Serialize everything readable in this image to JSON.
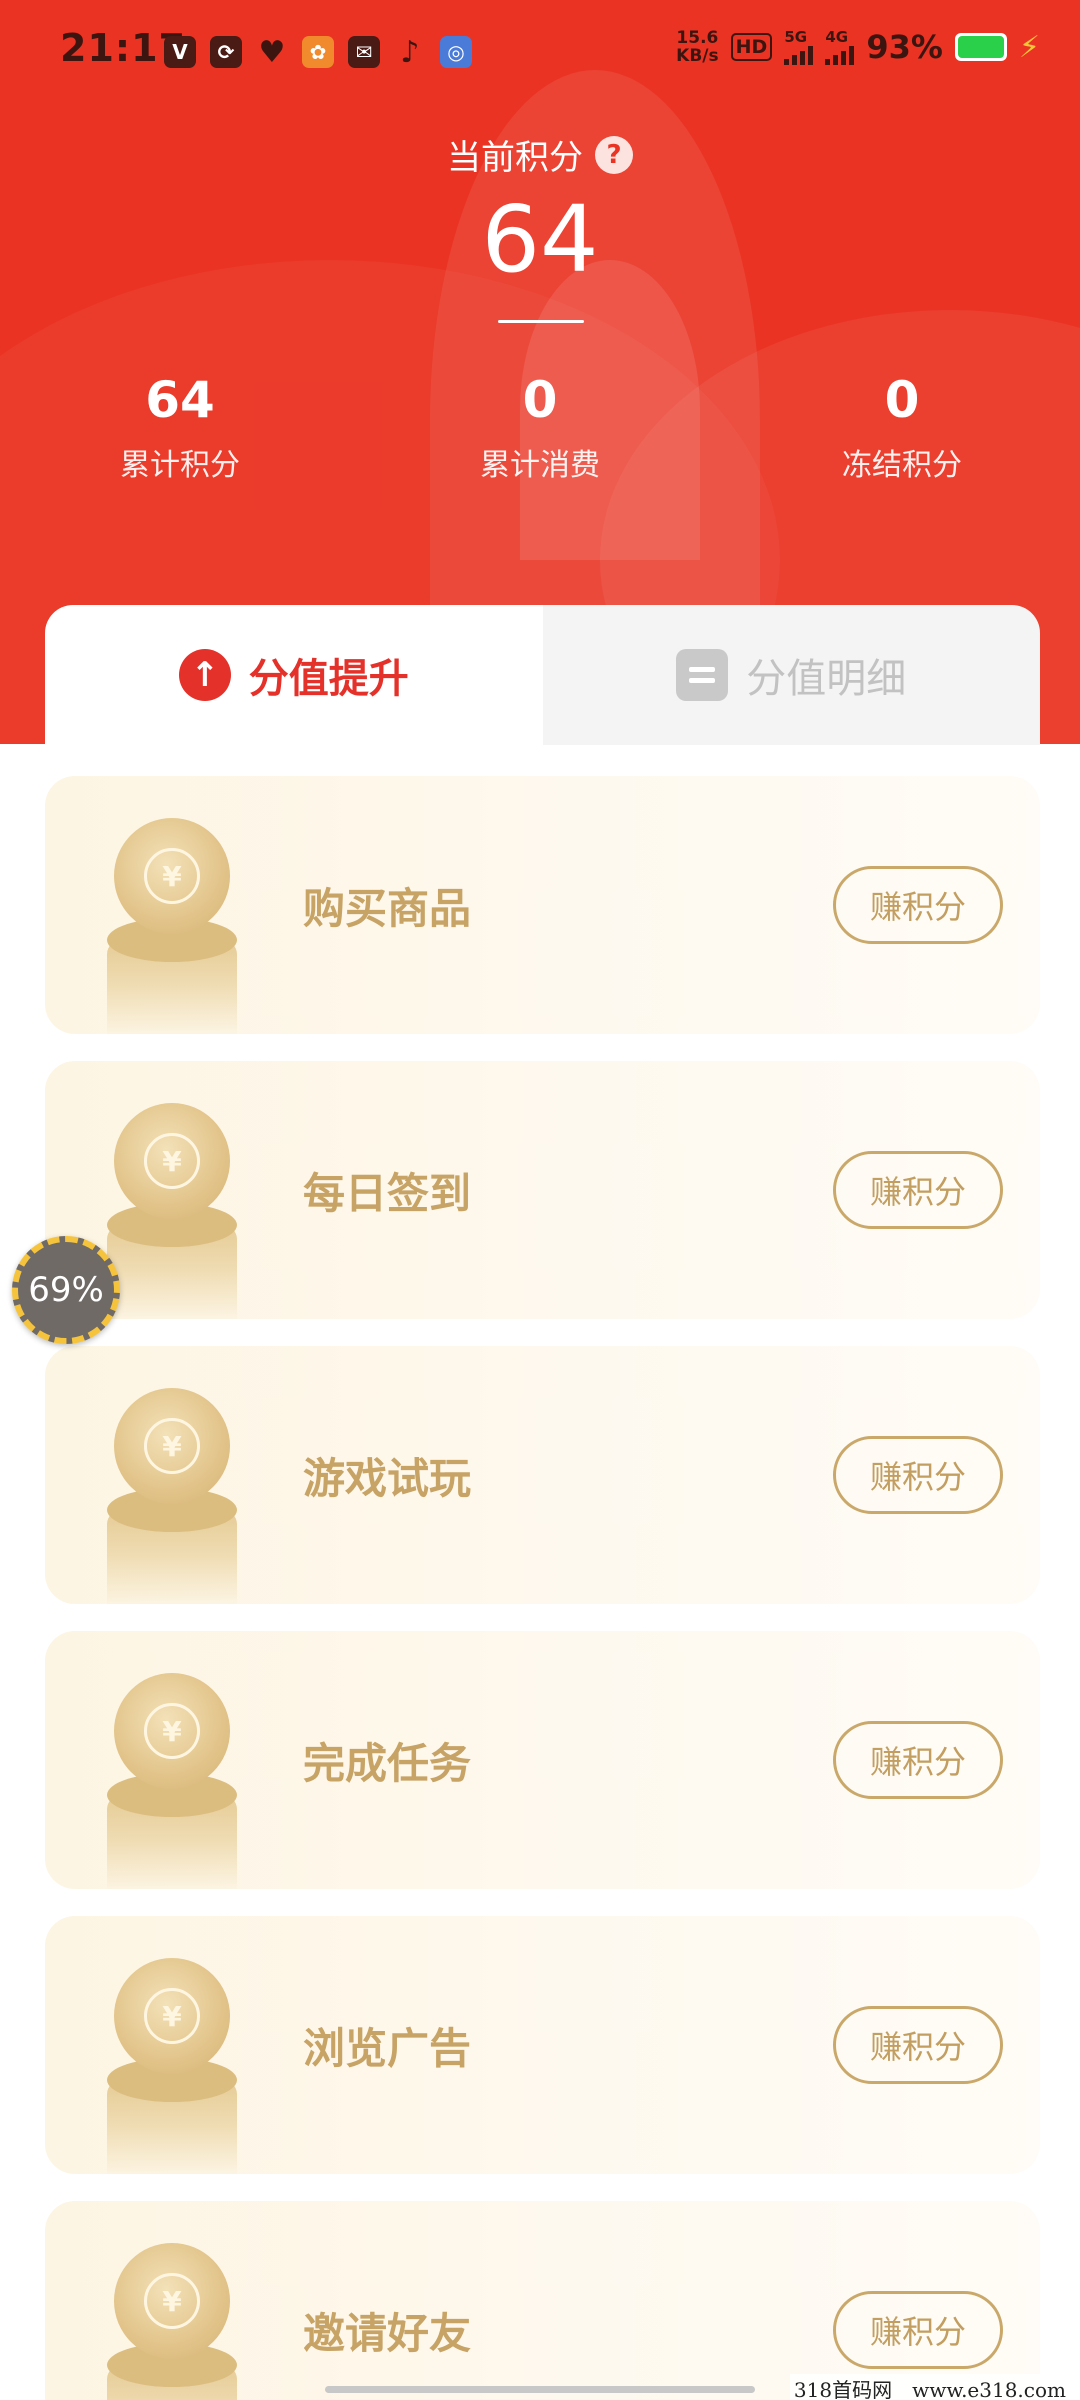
{
  "status_bar": {
    "time": "21:17",
    "notifications": [
      "video-app-icon",
      "refresh-app-icon",
      "shield-app-icon",
      "orange-app-icon",
      "mail-app-icon",
      "tiktok-icon",
      "browser-app-icon"
    ],
    "net_speed_value": "15.6",
    "net_speed_unit": "KB/s",
    "hd_label": "HD",
    "signal1_label": "5G",
    "signal2_label": "4G",
    "battery_percent": "93%",
    "battery_color": "#2ad04a"
  },
  "header": {
    "title": "当前积分",
    "help_symbol": "?",
    "current_points": "64",
    "accent_color": "#ea3323",
    "stats": [
      {
        "value": "64",
        "label": "累计积分"
      },
      {
        "value": "0",
        "label": "累计消费"
      },
      {
        "value": "0",
        "label": "冻结积分"
      }
    ]
  },
  "tabs": [
    {
      "label": "分值提升",
      "icon": "arrow-up-icon",
      "active": true
    },
    {
      "label": "分值明细",
      "icon": "list-doc-icon",
      "active": false
    }
  ],
  "earn_items": [
    {
      "title": "购买商品",
      "button": "赚积分"
    },
    {
      "title": "每日签到",
      "button": "赚积分"
    },
    {
      "title": "游戏试玩",
      "button": "赚积分"
    },
    {
      "title": "完成任务",
      "button": "赚积分"
    },
    {
      "title": "浏览广告",
      "button": "赚积分"
    },
    {
      "title": "邀请好友",
      "button": "赚积分"
    }
  ],
  "coin_symbol": "¥",
  "floating_progress": "69%",
  "watermark": "318首码网　www.e318.com"
}
